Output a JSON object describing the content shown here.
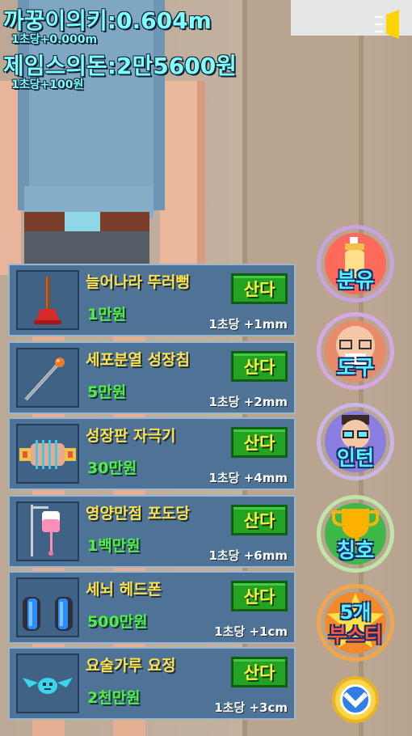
{
  "hud": {
    "height": "까꿍이의키:0.604m",
    "height_rate": "1초당+0.000m",
    "money": "제임스의돈:2만5600원",
    "money_rate": "1초당+100원"
  },
  "sound_icon": "speaker-icon",
  "shop": {
    "buy_label": "산다",
    "items": [
      {
        "name": "늘어나라 뚜러뻥",
        "price": "1만원",
        "rate": "1초당 +1mm",
        "icon": "plunger-icon"
      },
      {
        "name": "세포분열 성장침",
        "price": "5만원",
        "rate": "1초당 +2mm",
        "icon": "needle-icon"
      },
      {
        "name": "성장판 자극기",
        "price": "30만원",
        "rate": "1초당 +4mm",
        "icon": "stimulator-icon"
      },
      {
        "name": "영양만점 포도당",
        "price": "1백만원",
        "rate": "1초당 +6mm",
        "icon": "iv-drip-icon"
      },
      {
        "name": "세뇌 헤드폰",
        "price": "500만원",
        "rate": "1초당 +1cm",
        "icon": "headphones-icon"
      },
      {
        "name": "요술가루 요정",
        "price": "2천만원",
        "rate": "1초당 +3cm",
        "icon": "fairy-icon"
      }
    ]
  },
  "side_menu": {
    "items": [
      {
        "label": "분유",
        "icon": "baby-bottle-icon"
      },
      {
        "label": "도구",
        "icon": "grandpa-face-icon"
      },
      {
        "label": "인턴",
        "icon": "intern-face-icon"
      },
      {
        "label": "칭호",
        "icon": "trophy-icon"
      },
      {
        "label": "5개\n부스터",
        "line1": "5개",
        "line2": "부스터",
        "icon": "booster-star-icon"
      }
    ],
    "collapse_icon": "chevron-down-icon"
  },
  "colors": {
    "hud_text": "#7fffff",
    "item_name": "#ffe14a",
    "item_price": "#4cf23d",
    "buy_button": "#23a323",
    "panel": "#4f7397"
  }
}
